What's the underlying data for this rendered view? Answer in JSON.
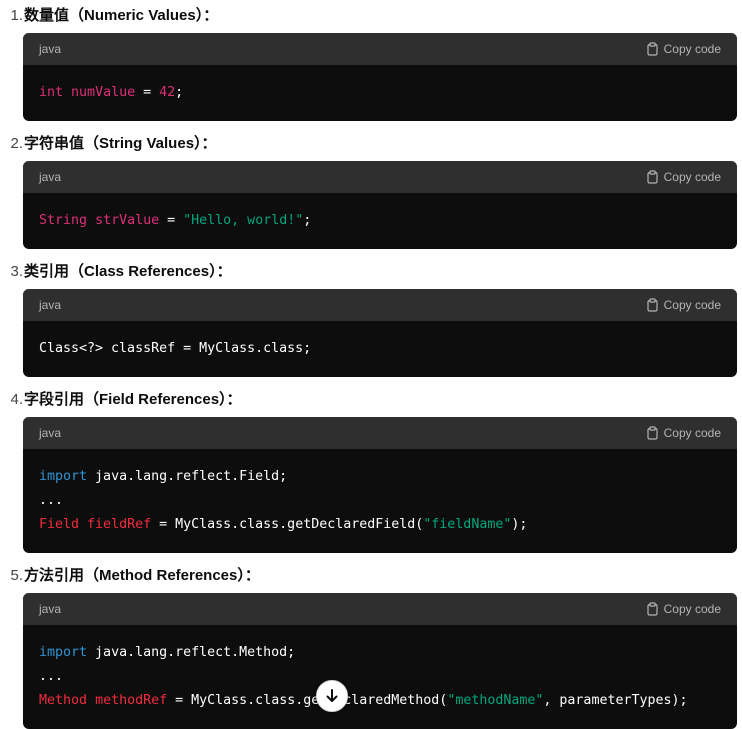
{
  "copy_label": "Copy code",
  "items": [
    {
      "number": "1.",
      "heading": "数量值（Numeric Values）：",
      "lang": "java",
      "code_lines": [
        [
          {
            "t": "int",
            "c": "num-lit"
          },
          {
            "t": " ",
            "c": "white"
          },
          {
            "t": "numValue",
            "c": "num-lit"
          },
          {
            "t": " = ",
            "c": "white"
          },
          {
            "t": "42",
            "c": "num-lit"
          },
          {
            "t": ";",
            "c": "white"
          }
        ]
      ]
    },
    {
      "number": "2.",
      "heading": "字符串值（String Values）：",
      "lang": "java",
      "code_lines": [
        [
          {
            "t": "String",
            "c": "num-lit"
          },
          {
            "t": " ",
            "c": "white"
          },
          {
            "t": "strValue",
            "c": "num-lit"
          },
          {
            "t": " = ",
            "c": "white"
          },
          {
            "t": "\"Hello, world!\"",
            "c": "str"
          },
          {
            "t": ";",
            "c": "white"
          }
        ]
      ]
    },
    {
      "number": "3.",
      "heading": "类引用（Class References）：",
      "lang": "java",
      "code_lines": [
        [
          {
            "t": "Class<?> classRef = MyClass.class;",
            "c": "white"
          }
        ]
      ]
    },
    {
      "number": "4.",
      "heading": "字段引用（Field References）：",
      "lang": "java",
      "code_lines": [
        [
          {
            "t": "import",
            "c": "kw-blue"
          },
          {
            "t": " java.lang.reflect.Field;",
            "c": "white"
          }
        ],
        [
          {
            "t": "...",
            "c": "white"
          }
        ],
        [
          {
            "t": "Field",
            "c": "kw-red"
          },
          {
            "t": " ",
            "c": "white"
          },
          {
            "t": "fieldRef",
            "c": "kw-red"
          },
          {
            "t": " = MyClass.class.getDeclaredField(",
            "c": "white"
          },
          {
            "t": "\"fieldName\"",
            "c": "str"
          },
          {
            "t": ");",
            "c": "white"
          }
        ]
      ]
    },
    {
      "number": "5.",
      "heading": "方法引用（Method References）：",
      "lang": "java",
      "code_lines": [
        [
          {
            "t": "import",
            "c": "kw-blue"
          },
          {
            "t": " java.lang.reflect.Method;",
            "c": "white"
          }
        ],
        [
          {
            "t": "...",
            "c": "white"
          }
        ],
        [
          {
            "t": "Method",
            "c": "kw-red"
          },
          {
            "t": " ",
            "c": "white"
          },
          {
            "t": "methodRef",
            "c": "kw-red"
          },
          {
            "t": " = MyClass.class.getDeclaredMethod(",
            "c": "white"
          },
          {
            "t": "\"methodName\"",
            "c": "str"
          },
          {
            "t": ", parameterTypes);",
            "c": "white"
          }
        ]
      ]
    }
  ]
}
